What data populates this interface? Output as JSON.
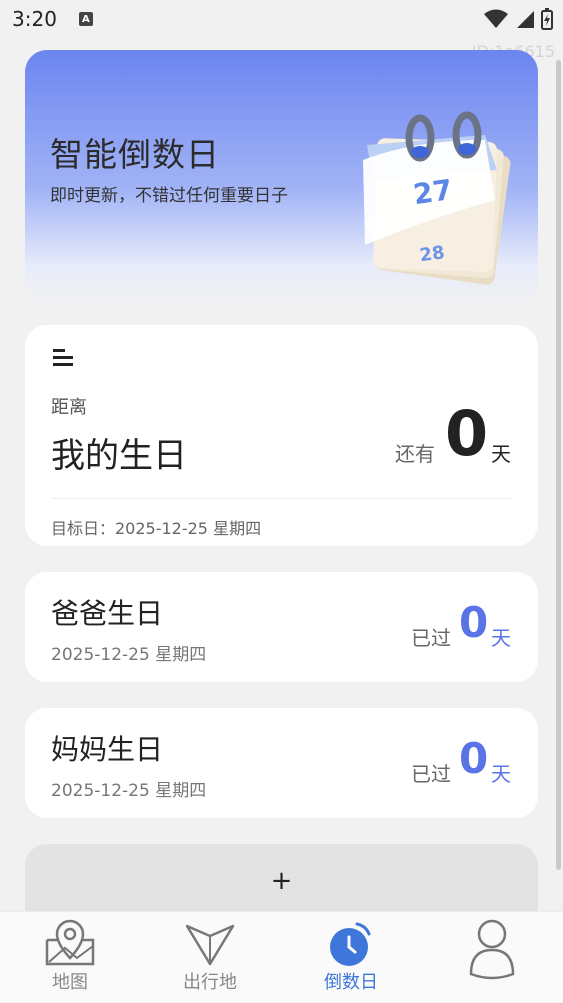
{
  "status_bar": {
    "time": "3:20",
    "notification_glyph": "A"
  },
  "watermark": "ID:1a6615",
  "hero": {
    "title": "智能倒数日",
    "subtitle": "即时更新，不错过任何重要日子",
    "calendar_number": "27",
    "calendar_number_back": "28"
  },
  "main_card": {
    "distance_label": "距离",
    "event_name": "我的生日",
    "prefix": "还有",
    "days": "0",
    "unit": "天",
    "target_date": "目标日：2025-12-25 星期四"
  },
  "events": [
    {
      "name": "爸爸生日",
      "date": "2025-12-25 星期四",
      "prefix": "已过",
      "days": "0",
      "unit": "天"
    },
    {
      "name": "妈妈生日",
      "date": "2025-12-25 星期四",
      "prefix": "已过",
      "days": "0",
      "unit": "天"
    }
  ],
  "add_card": {
    "plus": "+"
  },
  "tabs": [
    {
      "label": "地图",
      "icon": "map-pin-icon"
    },
    {
      "label": "出行地",
      "icon": "location-arrow-icon"
    },
    {
      "label": "倒数日",
      "icon": "alarm-clock-icon"
    },
    {
      "label": "",
      "icon": "person-icon"
    }
  ],
  "colors": {
    "accent": "#5a74e8",
    "tab_active": "#3f76d9",
    "hero_top": "#6b85f0"
  }
}
